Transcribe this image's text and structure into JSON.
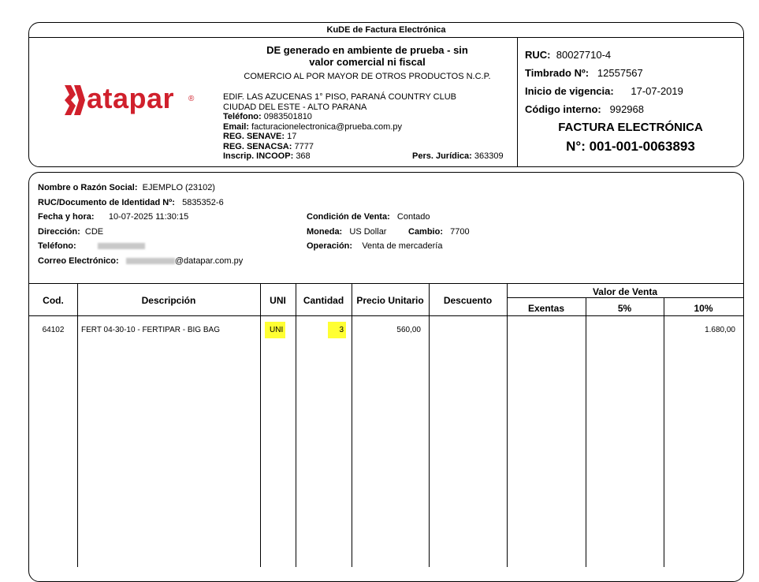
{
  "doc_title": "KuDE de Factura Electrónica",
  "header": {
    "logo_text": "atapar",
    "logo_mark": "®",
    "env_notice_line1": "DE generado en ambiente de prueba - sin",
    "env_notice_line2": "valor comercial ni fiscal",
    "activity": "COMERCIO AL POR MAYOR DE OTROS PRODUCTOS N.C.P.",
    "address1": "EDIF. LAS AZUCENAS 1° PISO, PARANÁ COUNTRY CLUB",
    "address2": "CIUDAD DEL ESTE - ALTO PARANA",
    "phone_label": "Teléfono:",
    "phone": "0983501810",
    "email_label": "Email:",
    "email": "facturacionelectronica@prueba.com.py",
    "senave_label": "REG. SENAVE:",
    "senave": "17",
    "senacsa_label": "REG. SENACSA:",
    "senacsa": "7777",
    "incoop_label": "Inscrip. INCOOP:",
    "incoop": "368",
    "pers_label": "Pers. Jurídica:",
    "pers": "363309",
    "ruc_label": "RUC:",
    "ruc": "80027710-4",
    "timbrado_label": "Timbrado Nº:",
    "timbrado": "12557567",
    "vigencia_label": "Inicio de vigencia:",
    "vigencia": "17-07-2019",
    "codigo_label": "Código interno:",
    "codigo": "992968",
    "invoice_type": "FACTURA ELECTRÓNICA",
    "invoice_number": "N°: 001-001-0063893"
  },
  "customer": {
    "name_label": "Nombre o Razón Social:",
    "name": "EJEMPLO (23102)",
    "ruc_label": "RUC/Documento de Identidad Nº:",
    "ruc": "5835352-6",
    "fecha_label": "Fecha y hora:",
    "fecha": "10-07-2025 11:30:15",
    "direccion_label": "Dirección:",
    "direccion": "CDE",
    "telefono_label": "Teléfono:",
    "correo_label": "Correo Electrónico:",
    "correo_domain": "@datapar.com.py",
    "condicion_label": "Condición de Venta:",
    "condicion": "Contado",
    "moneda_label": "Moneda:",
    "moneda": "US Dollar",
    "cambio_label": "Cambio:",
    "cambio": "7700",
    "operacion_label": "Operación:",
    "operacion": "Venta de mercadería"
  },
  "table": {
    "headers": {
      "cod": "Cod.",
      "descripcion": "Descripción",
      "uni": "UNI",
      "cantidad": "Cantidad",
      "precio": "Precio Unitario",
      "descuento": "Descuento",
      "valor_venta": "Valor de Venta",
      "exentas": "Exentas",
      "cinco": "5%",
      "diez": "10%"
    },
    "rows": [
      {
        "cod": "64102",
        "descripcion": "FERT 04-30-10 - FERTIPAR - BIG BAG",
        "uni": "UNI",
        "cantidad": "3",
        "precio": "560,00",
        "descuento": "",
        "exentas": "",
        "cinco": "",
        "diez": "1.680,00"
      }
    ]
  },
  "colors": {
    "logo_red": "#d0202c",
    "highlight": "#ffff33"
  }
}
